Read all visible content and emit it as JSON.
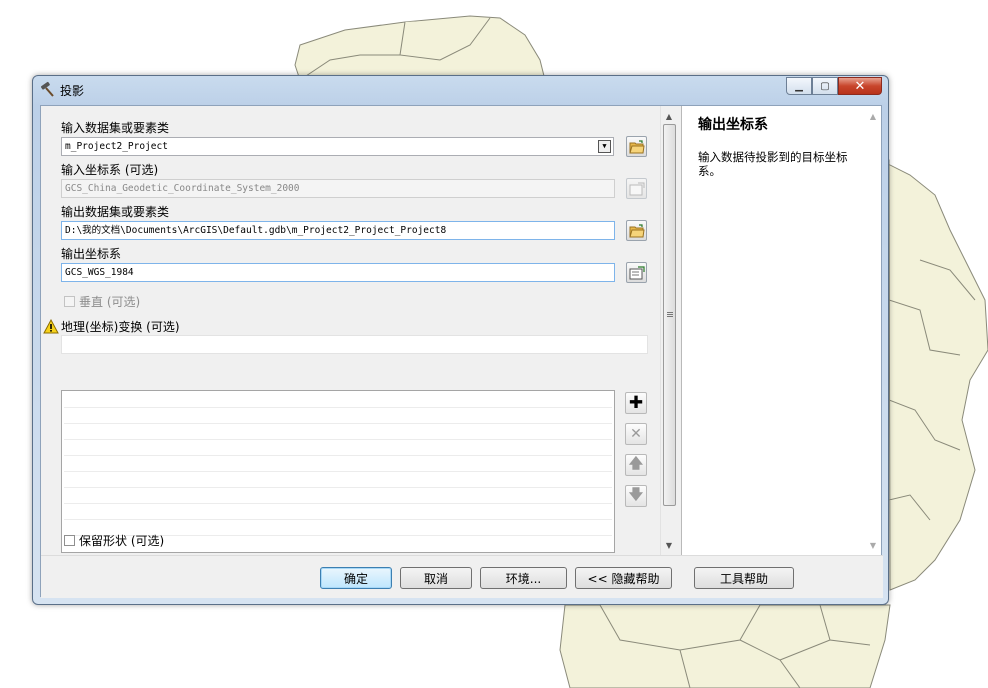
{
  "window": {
    "title": "投影",
    "minimize_icon": "minimize-icon",
    "maximize_icon": "maximize-icon",
    "close_icon": "close-icon"
  },
  "form": {
    "input_dataset": {
      "label": "输入数据集或要素类",
      "value": "m_Project2_Project"
    },
    "input_cs": {
      "label": "输入坐标系 (可选)",
      "value": "GCS_China_Geodetic_Coordinate_System_2000"
    },
    "output_dataset": {
      "label": "输出数据集或要素类",
      "value": "D:\\我的文档\\Documents\\ArcGIS\\Default.gdb\\m_Project2_Project_Project8"
    },
    "output_cs": {
      "label": "输出坐标系",
      "value": "GCS_WGS_1984"
    },
    "vertical": {
      "label": "垂直 (可选)",
      "checked": false,
      "enabled": false
    },
    "geo_transform": {
      "label": "地理(坐标)变换 (可选)",
      "warning_icon": "warning-icon",
      "value": ""
    },
    "list_buttons": {
      "add_icon": "plus-icon",
      "remove_icon": "x-icon",
      "up_icon": "arrow-up-icon",
      "down_icon": "arrow-down-icon"
    },
    "preserve_shape": {
      "label": "保留形状 (可选)",
      "checked": false
    }
  },
  "help": {
    "title": "输出坐标系",
    "body": "输入数据待投影到的目标坐标系。"
  },
  "buttons": {
    "ok": "确定",
    "cancel": "取消",
    "env": "环境...",
    "hide_help": "<< 隐藏帮助",
    "tool_help": "工具帮助"
  },
  "colors": {
    "map_fill": "#f3f2da",
    "map_stroke": "#8a8a7a",
    "titlebar": "#c9dbee",
    "close_button": "#c8452c",
    "default_button": "#bee6fd"
  }
}
